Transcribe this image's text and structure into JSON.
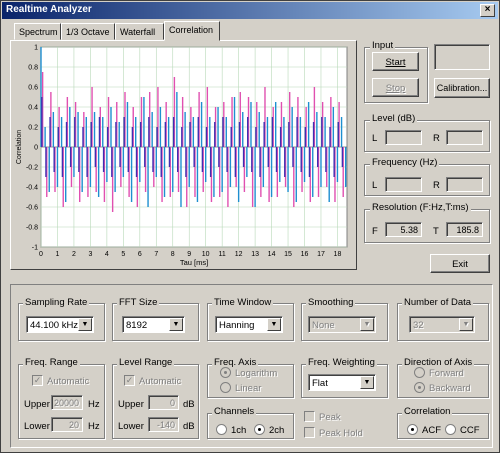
{
  "window": {
    "title": "Realtime Analyzer",
    "close_glyph": "×"
  },
  "tabs": [
    {
      "label": "Spectrum"
    },
    {
      "label": "1/3 Octave"
    },
    {
      "label": "Waterfall"
    },
    {
      "label": "Correlation"
    }
  ],
  "chart_data": {
    "type": "line",
    "title": "",
    "xlabel": "Tau [ms]",
    "ylabel": "Correlation",
    "xlim": [
      0,
      18.58
    ],
    "ylim": [
      -1,
      1
    ],
    "xticks": [
      "0",
      "1",
      "2",
      "3",
      "4",
      "5",
      "6",
      "7",
      "8",
      "9",
      "10",
      "11",
      "12",
      "13",
      "14",
      "15",
      "16",
      "17",
      "18"
    ],
    "yticks": [
      "1",
      "0.8",
      "0.6",
      "0.4",
      "0.2",
      "0",
      "-0.2",
      "-0.4",
      "-0.6",
      "-0.8",
      "-1"
    ],
    "grid": true,
    "series": [
      {
        "color": "#1e8fd0",
        "x": [
          0,
          0.25,
          0.5,
          0.75,
          1,
          1.25,
          1.5,
          1.75,
          2,
          2.25,
          2.5,
          2.75,
          3,
          3.25,
          3.5,
          3.75,
          4,
          4.25,
          4.5,
          4.75,
          5,
          5.25,
          5.5,
          5.75,
          6,
          6.25,
          6.5,
          6.75,
          7,
          7.25,
          7.5,
          7.75,
          8,
          8.25,
          8.5,
          8.75,
          9,
          9.25,
          9.5,
          9.75,
          10,
          10.25,
          10.5,
          10.75,
          11,
          11.25,
          11.5,
          11.75,
          12,
          12.25,
          12.5,
          12.75,
          13,
          13.25,
          13.5,
          13.75,
          14,
          14.25,
          14.5,
          14.75,
          15,
          15.25,
          15.5,
          15.75,
          16,
          16.25,
          16.5,
          16.75,
          17,
          17.25,
          17.5,
          17.75,
          18,
          18.25,
          18.5
        ],
        "y": [
          1,
          0.2,
          -0.45,
          0.35,
          -0.4,
          0.3,
          -0.55,
          0.4,
          -0.3,
          0.35,
          -0.45,
          0.3,
          -0.4,
          0.35,
          -0.5,
          0.3,
          -0.35,
          0.4,
          -0.45,
          0.25,
          -0.3,
          0.45,
          -0.55,
          0.3,
          -0.35,
          0.5,
          -0.6,
          0.35,
          -0.3,
          0.4,
          -0.5,
          0.3,
          -0.45,
          0.55,
          -0.6,
          0.35,
          -0.4,
          0.3,
          -0.55,
          0.45,
          -0.35,
          0.3,
          -0.5,
          0.4,
          -0.45,
          0.3,
          -0.4,
          0.5,
          -0.55,
          0.35,
          -0.3,
          0.45,
          -0.6,
          0.35,
          -0.4,
          0.3,
          -0.5,
          0.45,
          -0.35,
          0.3,
          -0.45,
          0.4,
          -0.55,
          0.3,
          -0.35,
          0.45,
          -0.5,
          0.35,
          -0.4,
          0.3,
          -0.55,
          0.4,
          -0.35,
          0.3,
          -0.4
        ]
      },
      {
        "color": "#e050b0",
        "x": [
          0.1,
          0.35,
          0.6,
          0.85,
          1.1,
          1.35,
          1.6,
          1.85,
          2.1,
          2.35,
          2.6,
          2.85,
          3.1,
          3.35,
          3.6,
          3.85,
          4.1,
          4.35,
          4.6,
          4.85,
          5.1,
          5.35,
          5.6,
          5.85,
          6.1,
          6.35,
          6.6,
          6.85,
          7.1,
          7.35,
          7.6,
          7.85,
          8.1,
          8.35,
          8.6,
          8.85,
          9.1,
          9.35,
          9.6,
          9.85,
          10.1,
          10.35,
          10.6,
          10.85,
          11.1,
          11.35,
          11.6,
          11.85,
          12.1,
          12.35,
          12.6,
          12.85,
          13.1,
          13.35,
          13.6,
          13.85,
          14.1,
          14.35,
          14.6,
          14.85,
          15.1,
          15.35,
          15.6,
          15.85,
          16.1,
          16.35,
          16.6,
          16.85,
          17.1,
          17.35,
          17.6,
          17.85,
          18.1,
          18.35
        ],
        "y": [
          0.75,
          -0.5,
          0.55,
          -0.45,
          0.4,
          -0.6,
          0.5,
          -0.4,
          0.45,
          -0.55,
          0.35,
          -0.5,
          0.6,
          -0.45,
          0.4,
          -0.55,
          0.5,
          -0.65,
          0.45,
          -0.4,
          0.55,
          -0.5,
          0.4,
          -0.6,
          0.5,
          -0.45,
          0.55,
          -0.4,
          0.6,
          -0.55,
          0.45,
          -0.5,
          0.7,
          -0.45,
          0.5,
          -0.6,
          0.4,
          -0.5,
          0.55,
          -0.45,
          0.6,
          -0.55,
          0.4,
          -0.5,
          0.45,
          -0.6,
          0.5,
          -0.4,
          0.55,
          -0.45,
          0.5,
          -0.6,
          0.45,
          -0.5,
          0.6,
          -0.55,
          0.4,
          -0.5,
          0.45,
          -0.4,
          0.55,
          -0.6,
          0.5,
          -0.45,
          0.4,
          -0.55,
          0.6,
          -0.5,
          0.45,
          -0.4,
          0.5,
          -0.55,
          0.45,
          -0.5
        ]
      },
      {
        "color": "#4030b0",
        "x": [
          0.05,
          0.3,
          0.55,
          0.8,
          1.05,
          1.3,
          1.55,
          1.8,
          2.05,
          2.3,
          2.55,
          2.8,
          3.05,
          3.3,
          3.55,
          3.8,
          4.05,
          4.3,
          4.55,
          4.8,
          5.05,
          5.3,
          5.55,
          5.8,
          6.05,
          6.3,
          6.55,
          6.8,
          7.05,
          7.3,
          7.55,
          7.8,
          8.05,
          8.3,
          8.55,
          8.8,
          9.05,
          9.3,
          9.55,
          9.8,
          10.05,
          10.3,
          10.55,
          10.8,
          11.05,
          11.3,
          11.55,
          11.8,
          12.05,
          12.3,
          12.55,
          12.8,
          13.05,
          13.3,
          13.55,
          13.8,
          14.05,
          14.3,
          14.55,
          14.8,
          15.05,
          15.3,
          15.55,
          15.8,
          16.05,
          16.3,
          16.55,
          16.8,
          17.05,
          17.3,
          17.55,
          17.8,
          18.05,
          18.3
        ],
        "y": [
          0.5,
          -0.3,
          0.3,
          -0.25,
          0.2,
          -0.3,
          0.25,
          -0.2,
          0.3,
          -0.25,
          0.2,
          -0.3,
          0.25,
          -0.2,
          0.3,
          -0.25,
          0.2,
          -0.3,
          0.25,
          -0.2,
          0.3,
          -0.25,
          0.2,
          -0.3,
          0.25,
          -0.2,
          0.3,
          -0.25,
          0.2,
          -0.3,
          0.25,
          -0.2,
          0.3,
          -0.25,
          0.2,
          -0.3,
          0.25,
          -0.2,
          0.3,
          -0.25,
          0.2,
          -0.3,
          0.25,
          -0.2,
          0.3,
          -0.25,
          0.2,
          -0.3,
          0.25,
          -0.2,
          0.3,
          -0.25,
          0.2,
          -0.3,
          0.25,
          -0.2,
          0.3,
          -0.25,
          0.2,
          -0.3,
          0.25,
          -0.2,
          0.3,
          -0.25,
          0.2,
          -0.3,
          0.25,
          -0.2,
          0.3,
          -0.25,
          0.2,
          -0.3,
          0.25,
          -0.2
        ]
      }
    ]
  },
  "input": {
    "group_label": "Input",
    "start_label": "Start",
    "stop_label": "Stop",
    "calibration_label": "Calibration..."
  },
  "level": {
    "group_label": "Level (dB)",
    "l_label": "L",
    "r_label": "R",
    "l_value": "",
    "r_value": ""
  },
  "frequency": {
    "group_label": "Frequency (Hz)",
    "l_label": "L",
    "r_label": "R",
    "l_value": "",
    "r_value": ""
  },
  "resolution": {
    "group_label": "Resolution (F:Hz,T:ms)",
    "f_label": "F",
    "f_value": "5.38",
    "t_label": "T",
    "t_value": "185.8"
  },
  "exit_label": "Exit",
  "sampling_rate": {
    "group_label": "Sampling Rate",
    "value": "44.100 kHz"
  },
  "fft_size": {
    "group_label": "FFT Size",
    "value": "8192"
  },
  "time_window": {
    "group_label": "Time Window",
    "value": "Hanning"
  },
  "smoothing": {
    "group_label": "Smoothing",
    "value": "None"
  },
  "number_of_data": {
    "group_label": "Number of Data",
    "value": "32"
  },
  "freq_range": {
    "group_label": "Freq. Range",
    "automatic_label": "Automatic",
    "upper_label": "Upper",
    "upper_value": "20000",
    "upper_unit": "Hz",
    "lower_label": "Lower",
    "lower_value": "20",
    "lower_unit": "Hz"
  },
  "level_range": {
    "group_label": "Level Range",
    "automatic_label": "Automatic",
    "upper_label": "Upper",
    "upper_value": "0",
    "upper_unit": "dB",
    "lower_label": "Lower",
    "lower_value": "-140",
    "lower_unit": "dB"
  },
  "freq_axis": {
    "group_label": "Freq. Axis",
    "logarithm_label": "Logarithm",
    "linear_label": "Linear"
  },
  "channels": {
    "group_label": "Channels",
    "ch1_label": "1ch",
    "ch2_label": "2ch"
  },
  "freq_weighting": {
    "group_label": "Freq. Weighting",
    "value": "Flat",
    "peak_label": "Peak",
    "peak_hold_label": "Peak Hold"
  },
  "direction_of_axis": {
    "group_label": "Direction of Axis",
    "forward_label": "Forward",
    "backward_label": "Backward"
  },
  "correlation": {
    "group_label": "Correlation",
    "acf_label": "ACF",
    "ccf_label": "CCF"
  },
  "glyphs": {
    "dropdown_arrow": "▼",
    "checkmark": "✓"
  }
}
